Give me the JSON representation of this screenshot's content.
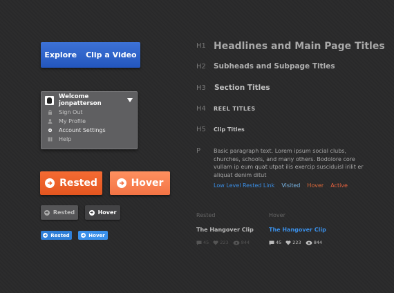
{
  "nav": {
    "explore": "Explore",
    "clip": "Clip a Video"
  },
  "dropdown": {
    "title": "Welcome jonpatterson",
    "items": [
      {
        "label": "Sign Out",
        "icon": "lock-icon"
      },
      {
        "label": "My Profile",
        "icon": "person-icon"
      },
      {
        "label": "Account Settings",
        "icon": "gear-icon"
      },
      {
        "label": "Help",
        "icon": "book-icon"
      }
    ]
  },
  "buttons": {
    "large_rested": "Rested",
    "large_hover": "Hover",
    "small_rested": "Rested",
    "small_hover": "Hover",
    "tiny_rested": "Rested",
    "tiny_hover": "Hover"
  },
  "type": {
    "h1_tag": "H1",
    "h1": "Headlines and Main Page Titles",
    "h2_tag": "H2",
    "h2": "Subheads and Subpage Titles",
    "h3_tag": "H3",
    "h3": "Section Titles",
    "h4_tag": "H4",
    "h4": "REEL TITLES",
    "h5_tag": "H5",
    "h5": "Clip Titles",
    "p_tag": "P",
    "paragraph": "Basic paragraph text. Lorem ipsum social clubs, churches, schools, and many others. Bodolore core vullam ip eum quat utpat ilis exercip susciduisl irilit er aliquat denim ditut",
    "links": {
      "rested": "Low Level Rested Link",
      "visited": "Visited",
      "hover": "Hover",
      "active": "Active"
    }
  },
  "clips": {
    "rested": {
      "caption": "Rested",
      "title": "The Hangover Clip",
      "comments": "45",
      "likes": "223",
      "views": "844"
    },
    "hover": {
      "caption": "Hover",
      "title": "The Hangover Clip",
      "comments": "45",
      "likes": "223",
      "views": "844"
    }
  },
  "colors": {
    "nav_blue": "#2a5fc8",
    "orange": "#f26a32",
    "link_blue": "#3a8ee6",
    "link_visited": "#7ab7e8",
    "link_hover": "#e06a3a",
    "link_active": "#e8623e"
  }
}
